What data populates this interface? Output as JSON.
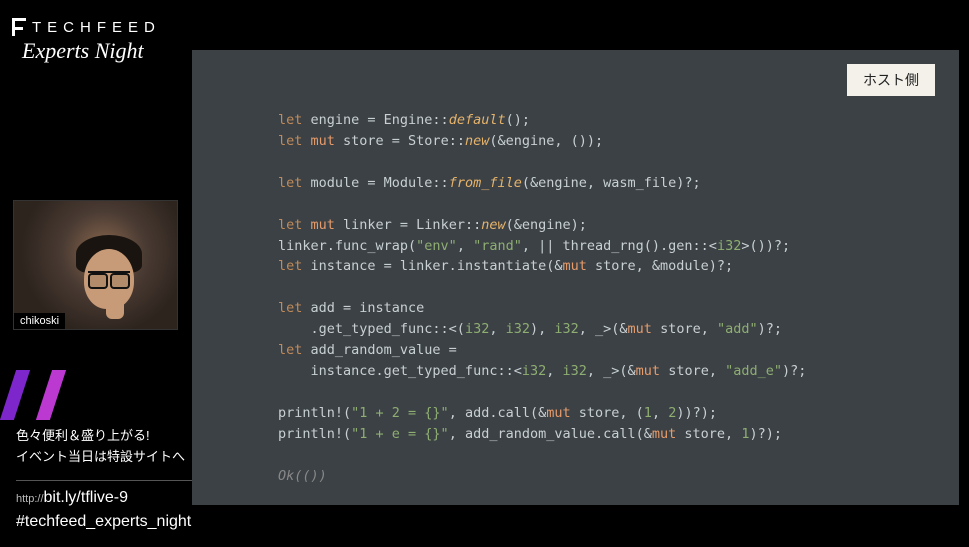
{
  "logo": {
    "brand": "TECHFEED",
    "sub": "Experts Night"
  },
  "webcam": {
    "name": "chikoski"
  },
  "announce": {
    "line1": "色々便利＆盛り上がる!",
    "line2": "イベント当日は特設サイトへ"
  },
  "url": {
    "prefix": "http://",
    "path": "bit.ly/tflive-9"
  },
  "hashtag": "#techfeed_experts_night",
  "slide": {
    "badge": "ホスト側",
    "code": {
      "lines": [
        [
          {
            "t": "let ",
            "c": "kw"
          },
          {
            "t": "engine = Engine::"
          },
          {
            "t": "default",
            "c": "call"
          },
          {
            "t": "();"
          }
        ],
        [
          {
            "t": "let ",
            "c": "kw"
          },
          {
            "t": "mut ",
            "c": "kw2"
          },
          {
            "t": "store = Store::"
          },
          {
            "t": "new",
            "c": "call"
          },
          {
            "t": "(&engine, ());"
          }
        ],
        [],
        [
          {
            "t": "let ",
            "c": "kw"
          },
          {
            "t": "module = Module::"
          },
          {
            "t": "from_file",
            "c": "call"
          },
          {
            "t": "(&engine, wasm_file)?;"
          }
        ],
        [],
        [
          {
            "t": "let ",
            "c": "kw"
          },
          {
            "t": "mut ",
            "c": "kw2"
          },
          {
            "t": "linker = Linker::"
          },
          {
            "t": "new",
            "c": "call"
          },
          {
            "t": "(&engine);"
          }
        ],
        [
          {
            "t": "linker.func_wrap("
          },
          {
            "t": "\"env\"",
            "c": "str"
          },
          {
            "t": ", "
          },
          {
            "t": "\"rand\"",
            "c": "str"
          },
          {
            "t": ", || thread_rng().gen::<"
          },
          {
            "t": "i32",
            "c": "typp"
          },
          {
            "t": ">())?;"
          }
        ],
        [
          {
            "t": "let ",
            "c": "kw"
          },
          {
            "t": "instance = linker.instantiate(&"
          },
          {
            "t": "mut ",
            "c": "kw2"
          },
          {
            "t": "store, &module)?;"
          }
        ],
        [],
        [
          {
            "t": "let ",
            "c": "kw"
          },
          {
            "t": "add = instance"
          }
        ],
        [
          {
            "t": "    .get_typed_func::<("
          },
          {
            "t": "i32",
            "c": "typp"
          },
          {
            "t": ", "
          },
          {
            "t": "i32",
            "c": "typp"
          },
          {
            "t": "), "
          },
          {
            "t": "i32",
            "c": "typp"
          },
          {
            "t": ", _>(&"
          },
          {
            "t": "mut ",
            "c": "kw2"
          },
          {
            "t": "store, "
          },
          {
            "t": "\"add\"",
            "c": "str"
          },
          {
            "t": ")?;"
          }
        ],
        [
          {
            "t": "let ",
            "c": "kw"
          },
          {
            "t": "add_random_value ="
          }
        ],
        [
          {
            "t": "    instance.get_typed_func::<"
          },
          {
            "t": "i32",
            "c": "typp"
          },
          {
            "t": ", "
          },
          {
            "t": "i32",
            "c": "typp"
          },
          {
            "t": ", _>(&"
          },
          {
            "t": "mut ",
            "c": "kw2"
          },
          {
            "t": "store, "
          },
          {
            "t": "\"add_e\"",
            "c": "str"
          },
          {
            "t": ")?;"
          }
        ],
        [],
        [
          {
            "t": "println!("
          },
          {
            "t": "\"1 + 2 = {}\"",
            "c": "str"
          },
          {
            "t": ", add.call(&"
          },
          {
            "t": "mut ",
            "c": "kw2"
          },
          {
            "t": "store, ("
          },
          {
            "t": "1",
            "c": "typp"
          },
          {
            "t": ", "
          },
          {
            "t": "2",
            "c": "typp"
          },
          {
            "t": "))?);"
          }
        ],
        [
          {
            "t": "println!("
          },
          {
            "t": "\"1 + e = {}\"",
            "c": "str"
          },
          {
            "t": ", add_random_value.call(&"
          },
          {
            "t": "mut ",
            "c": "kw2"
          },
          {
            "t": "store, "
          },
          {
            "t": "1",
            "c": "typp"
          },
          {
            "t": ")?);"
          }
        ],
        [],
        [
          {
            "t": "Ok",
            "c": "dim"
          },
          {
            "t": "(())",
            "c": "dim"
          }
        ]
      ]
    }
  }
}
